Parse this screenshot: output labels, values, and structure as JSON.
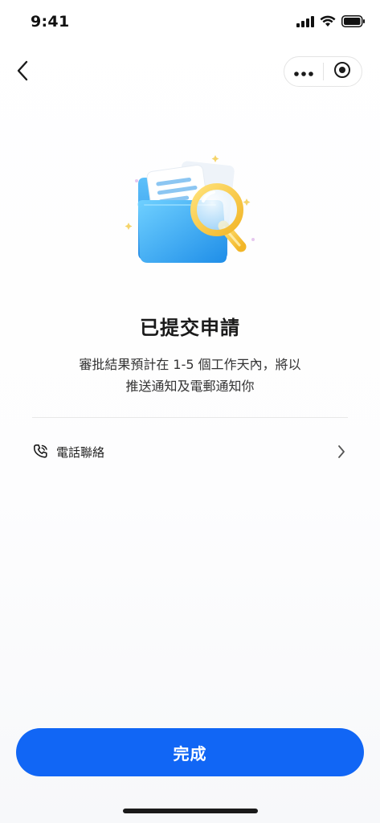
{
  "status_bar": {
    "time": "9:41"
  },
  "nav": {
    "back_icon": "chevron-left-icon",
    "more_icon": "more-dots-icon",
    "close_icon": "target-circle-icon"
  },
  "illustration": {
    "icon": "folder-magnifier-illustration"
  },
  "content": {
    "title": "已提交申請",
    "description_line1": "審批結果預計在 1-5 個工作天內，將以",
    "description_line2": "推送通知及電郵通知你"
  },
  "contact": {
    "icon": "phone-icon",
    "label": "電話聯絡",
    "chevron_icon": "chevron-right-icon"
  },
  "footer": {
    "done_label": "完成"
  },
  "colors": {
    "primary": "#1166f5",
    "folder_blue": "#2ea3f2",
    "magnifier_yellow": "#f7c948"
  }
}
